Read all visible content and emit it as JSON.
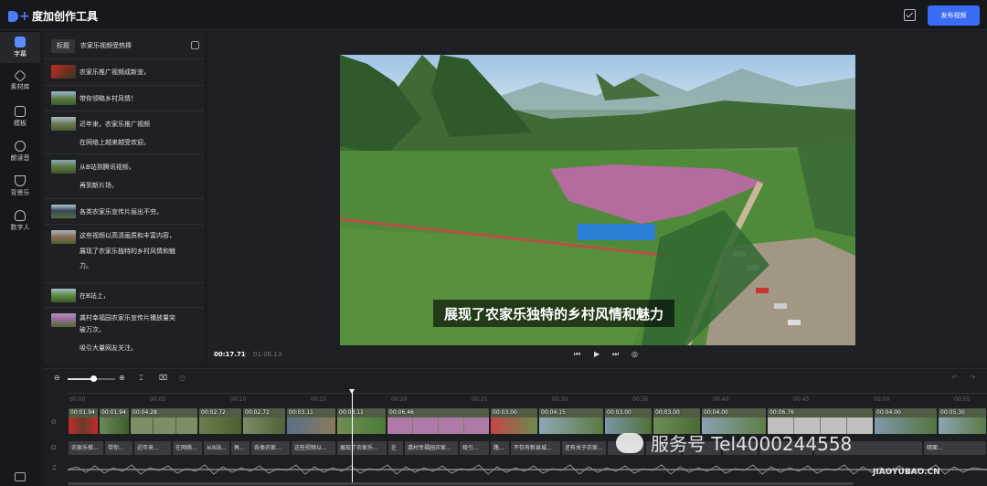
{
  "app": {
    "name": "度加创作工具",
    "publish_label": "发布视频"
  },
  "rail": [
    {
      "label": "字幕",
      "active": true
    },
    {
      "label": "素材库"
    },
    {
      "label": "模板"
    },
    {
      "label": "朗读音"
    },
    {
      "label": "背景乐"
    },
    {
      "label": "数字人"
    }
  ],
  "panel": {
    "tag": "标题",
    "title": "农家乐视频受热捧",
    "items": [
      {
        "lines": [
          "农家乐推广视频成新宠，"
        ]
      },
      {
        "lines": [
          "带你领略乡村风情！"
        ]
      },
      {
        "lines": [
          "近年来，农家乐推广视频",
          "在网络上越来越受欢迎。"
        ]
      },
      {
        "lines": [
          "从B站到腾讯视频，",
          "再到新片场，"
        ]
      },
      {
        "lines": [
          "各类农家乐宣传片层出不穷。"
        ]
      },
      {
        "lines": [
          "这些视频以高清画质和丰富内容，",
          "展现了农家乐独特的乡村风情和魅",
          "力。"
        ]
      },
      {
        "lines": [
          "在B站上，"
        ]
      },
      {
        "lines": [
          "龚村幸福园农家乐宣传片播放量突",
          "破万次，",
          "吸引大量网友关注。"
        ]
      }
    ]
  },
  "preview": {
    "caption": "展现了农家乐独特的乡村风情和魅力",
    "time_current": "00:17.71",
    "time_separator": "/",
    "time_total": "01:06.13"
  },
  "timeline": {
    "ruler": [
      "00:00",
      "00:05",
      "00:10",
      "00:15",
      "00:20",
      "00:25",
      "00:30",
      "00:35",
      "00:40",
      "00:45",
      "00:50",
      "00:55"
    ],
    "video_clips": [
      "00:01.94",
      "00:01.94",
      "00:04.28",
      "00:02.72",
      "00:02.72",
      "00:03.11",
      "00:03.11",
      "00:06.46",
      "00:03.00",
      "00:04.15",
      "00:03.00",
      "00:03.00",
      "00:04.00",
      "00:06.76",
      "00:04.00",
      "00:05.30"
    ],
    "subtitle_clips": [
      "农家乐推...",
      "带你...",
      "近年来...",
      "在网络...",
      "从B站...",
      "再...",
      "各类农家...",
      "这些视频以...",
      "展现了农家乐...",
      "在",
      "龚村幸福园农家...",
      "吸引...",
      "路...",
      "不仅有新县城...",
      "还有关于农家...",
      "",
      "",
      "",
      "",
      "",
      "...",
      "暗面..."
    ]
  },
  "watermark": {
    "text": "服务号 Tel4000244558",
    "small": "JIAOYUBAO.CN"
  }
}
